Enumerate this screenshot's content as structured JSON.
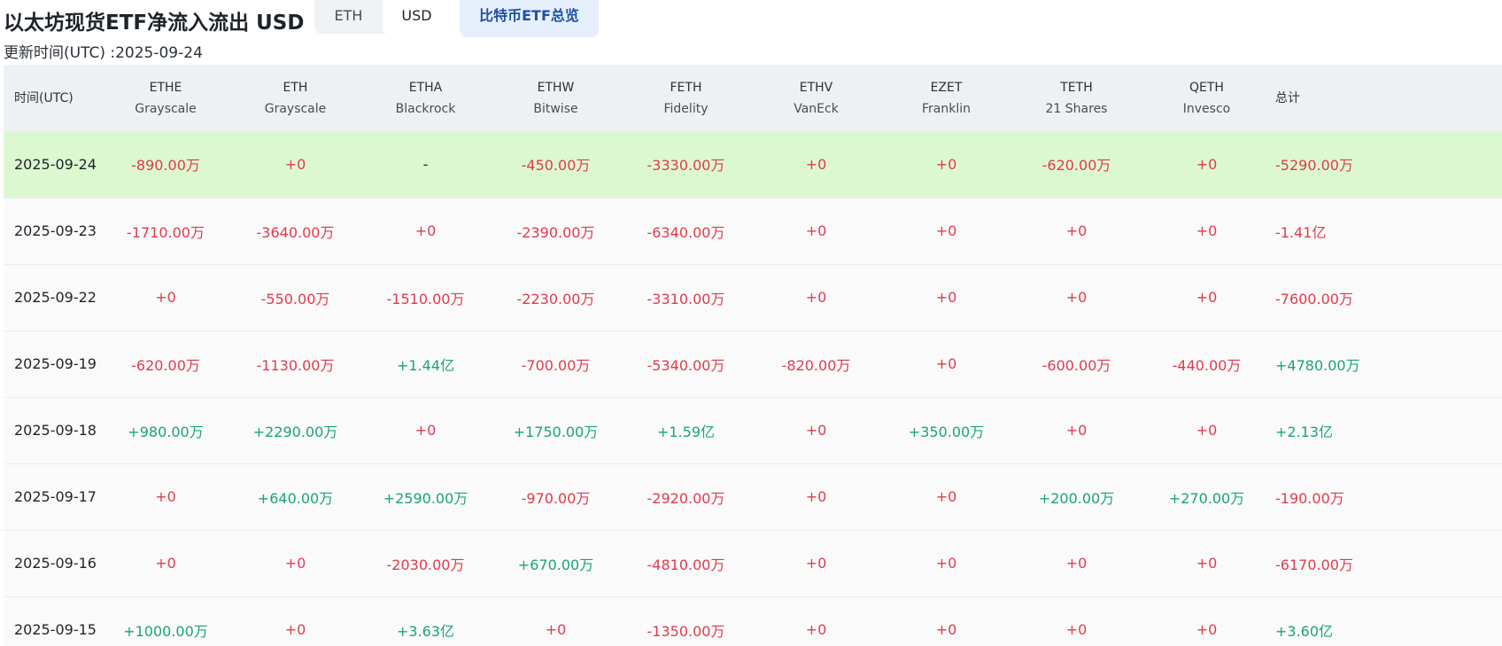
{
  "header": {
    "title": "以太坊现货ETF净流入流出 USD",
    "toggle": {
      "eth_label": "ETH",
      "usd_label": "USD",
      "selected": "USD"
    },
    "overview_label": "比特币ETF总览",
    "update_time": "更新时间(UTC) :2025-09-24"
  },
  "colors": {
    "negative": "#e03b4c",
    "positive": "#1aa37a",
    "highlight_row": "#dcf8d0"
  },
  "table": {
    "time_header": "时间(UTC)",
    "total_header": "总计",
    "columns": [
      {
        "ticker": "ETHE",
        "issuer": "Grayscale"
      },
      {
        "ticker": "ETH",
        "issuer": "Grayscale"
      },
      {
        "ticker": "ETHA",
        "issuer": "Blackrock"
      },
      {
        "ticker": "ETHW",
        "issuer": "Bitwise"
      },
      {
        "ticker": "FETH",
        "issuer": "Fidelity"
      },
      {
        "ticker": "ETHV",
        "issuer": "VanEck"
      },
      {
        "ticker": "EZET",
        "issuer": "Franklin"
      },
      {
        "ticker": "TETH",
        "issuer": "21 Shares"
      },
      {
        "ticker": "QETH",
        "issuer": "Invesco"
      }
    ],
    "rows": [
      {
        "date": "2025-09-24",
        "highlight": true,
        "values": [
          "-890.00万",
          "+0",
          "-",
          "-450.00万",
          "-3330.00万",
          "+0",
          "+0",
          "-620.00万",
          "+0"
        ],
        "total": "-5290.00万"
      },
      {
        "date": "2025-09-23",
        "highlight": false,
        "values": [
          "-1710.00万",
          "-3640.00万",
          "+0",
          "-2390.00万",
          "-6340.00万",
          "+0",
          "+0",
          "+0",
          "+0"
        ],
        "total": "-1.41亿"
      },
      {
        "date": "2025-09-22",
        "highlight": false,
        "values": [
          "+0",
          "-550.00万",
          "-1510.00万",
          "-2230.00万",
          "-3310.00万",
          "+0",
          "+0",
          "+0",
          "+0"
        ],
        "total": "-7600.00万"
      },
      {
        "date": "2025-09-19",
        "highlight": false,
        "values": [
          "-620.00万",
          "-1130.00万",
          "+1.44亿",
          "-700.00万",
          "-5340.00万",
          "-820.00万",
          "+0",
          "-600.00万",
          "-440.00万"
        ],
        "total": "+4780.00万"
      },
      {
        "date": "2025-09-18",
        "highlight": false,
        "values": [
          "+980.00万",
          "+2290.00万",
          "+0",
          "+1750.00万",
          "+1.59亿",
          "+0",
          "+350.00万",
          "+0",
          "+0"
        ],
        "total": "+2.13亿"
      },
      {
        "date": "2025-09-17",
        "highlight": false,
        "values": [
          "+0",
          "+640.00万",
          "+2590.00万",
          "-970.00万",
          "-2920.00万",
          "+0",
          "+0",
          "+200.00万",
          "+270.00万"
        ],
        "total": "-190.00万"
      },
      {
        "date": "2025-09-16",
        "highlight": false,
        "values": [
          "+0",
          "+0",
          "-2030.00万",
          "+670.00万",
          "-4810.00万",
          "+0",
          "+0",
          "+0",
          "+0"
        ],
        "total": "-6170.00万"
      },
      {
        "date": "2025-09-15",
        "highlight": false,
        "values": [
          "+1000.00万",
          "+0",
          "+3.63亿",
          "+0",
          "-1350.00万",
          "+0",
          "+0",
          "+0",
          "+0"
        ],
        "total": "+3.60亿"
      }
    ]
  }
}
